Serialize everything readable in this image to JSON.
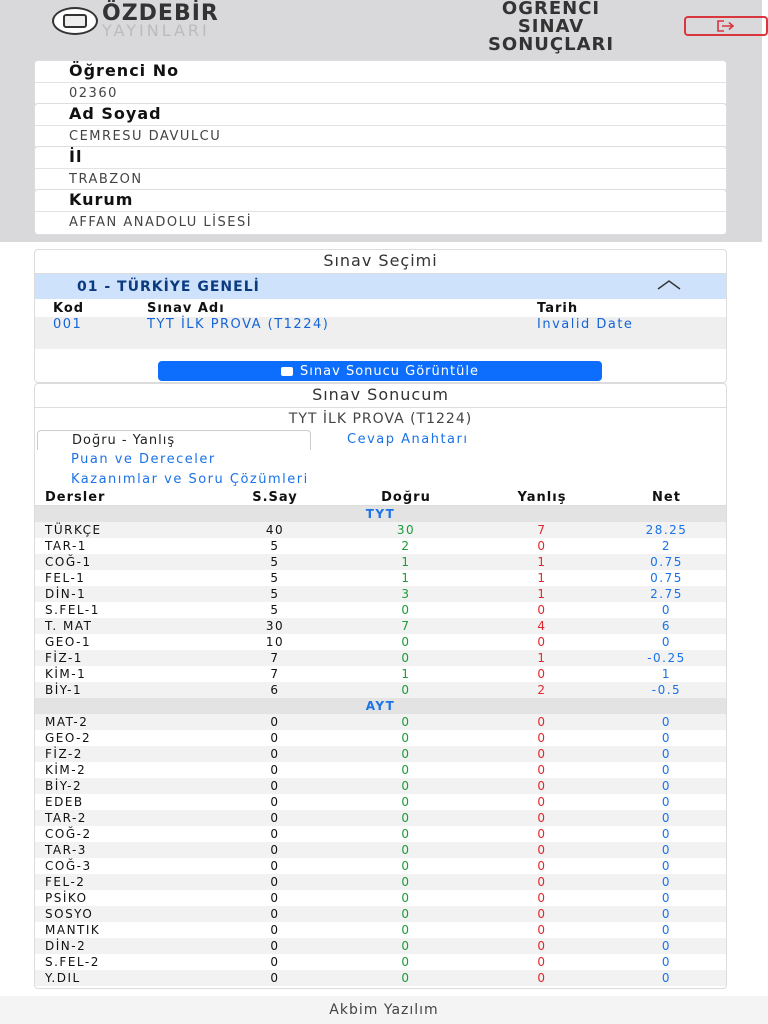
{
  "header": {
    "logo_brand": "ÖZDEBİR",
    "logo_sub": "YAYINLARI",
    "title_lines": [
      "ÖĞRENCİ",
      "SINAV",
      "SONUÇLARI"
    ],
    "logout_icon": "sign-out-icon"
  },
  "student": {
    "no_label": "Öğrenci No",
    "no_value": "02360",
    "name_label": "Ad Soyad",
    "name_value": "CEMRESU DAVULCU",
    "city_label": "İl",
    "city_value": "TRABZON",
    "school_label": "Kurum",
    "school_value": "AFFAN ANADOLU LİSESİ"
  },
  "selection": {
    "title": "Sınav Seçimi",
    "group": "01 - TÜRKİYE GENELİ",
    "columns": [
      "Kod",
      "Sınav Adı",
      "Tarih"
    ],
    "exam": {
      "code": "001",
      "name": "TYT İLK PROVA (T1224)",
      "date": "Invalid Date"
    },
    "button": "Sınav Sonucu Görüntüle"
  },
  "result": {
    "title": "Sınav Sonucum",
    "exam_name": "TYT İLK PROVA (T1224)",
    "tabs": [
      "Doğru - Yanlış",
      "Cevap Anahtarı",
      "Puan ve Dereceler",
      "Kazanımlar ve Soru Çözümleri"
    ],
    "columns": [
      "Dersler",
      "S.Say",
      "Doğru",
      "Yanlış",
      "Net"
    ],
    "sections": [
      {
        "name": "TYT",
        "rows": [
          [
            "TÜRKÇE",
            "40",
            "30",
            "7",
            "28.25"
          ],
          [
            "TAR-1",
            "5",
            "2",
            "0",
            "2"
          ],
          [
            "COĞ-1",
            "5",
            "1",
            "1",
            "0.75"
          ],
          [
            "FEL-1",
            "5",
            "1",
            "1",
            "0.75"
          ],
          [
            "DİN-1",
            "5",
            "3",
            "1",
            "2.75"
          ],
          [
            "S.FEL-1",
            "5",
            "0",
            "0",
            "0"
          ],
          [
            "T. MAT",
            "30",
            "7",
            "4",
            "6"
          ],
          [
            "GEO-1",
            "10",
            "0",
            "0",
            "0"
          ],
          [
            "FİZ-1",
            "7",
            "0",
            "1",
            "-0.25"
          ],
          [
            "KİM-1",
            "7",
            "1",
            "0",
            "1"
          ],
          [
            "BİY-1",
            "6",
            "0",
            "2",
            "-0.5"
          ]
        ]
      },
      {
        "name": "AYT",
        "rows": [
          [
            "MAT-2",
            "0",
            "0",
            "0",
            "0"
          ],
          [
            "GEO-2",
            "0",
            "0",
            "0",
            "0"
          ],
          [
            "FİZ-2",
            "0",
            "0",
            "0",
            "0"
          ],
          [
            "KİM-2",
            "0",
            "0",
            "0",
            "0"
          ],
          [
            "BİY-2",
            "0",
            "0",
            "0",
            "0"
          ],
          [
            "EDEB",
            "0",
            "0",
            "0",
            "0"
          ],
          [
            "TAR-2",
            "0",
            "0",
            "0",
            "0"
          ],
          [
            "COĞ-2",
            "0",
            "0",
            "0",
            "0"
          ],
          [
            "TAR-3",
            "0",
            "0",
            "0",
            "0"
          ],
          [
            "COĞ-3",
            "0",
            "0",
            "0",
            "0"
          ],
          [
            "FEL-2",
            "0",
            "0",
            "0",
            "0"
          ],
          [
            "PSİKO",
            "0",
            "0",
            "0",
            "0"
          ],
          [
            "SOSYO",
            "0",
            "0",
            "0",
            "0"
          ],
          [
            "MANTIK",
            "0",
            "0",
            "0",
            "0"
          ],
          [
            "DİN-2",
            "0",
            "0",
            "0",
            "0"
          ],
          [
            "S.FEL-2",
            "0",
            "0",
            "0",
            "0"
          ],
          [
            "Y.DIL",
            "0",
            "0",
            "0",
            "0"
          ]
        ]
      }
    ]
  },
  "footer": "Akbim Yazılım",
  "colors": {
    "accent": "#0d6efd",
    "correct": "#1a9c3a",
    "wrong": "#e0282e",
    "net": "#1a73e8",
    "logout": "#d9363e"
  }
}
